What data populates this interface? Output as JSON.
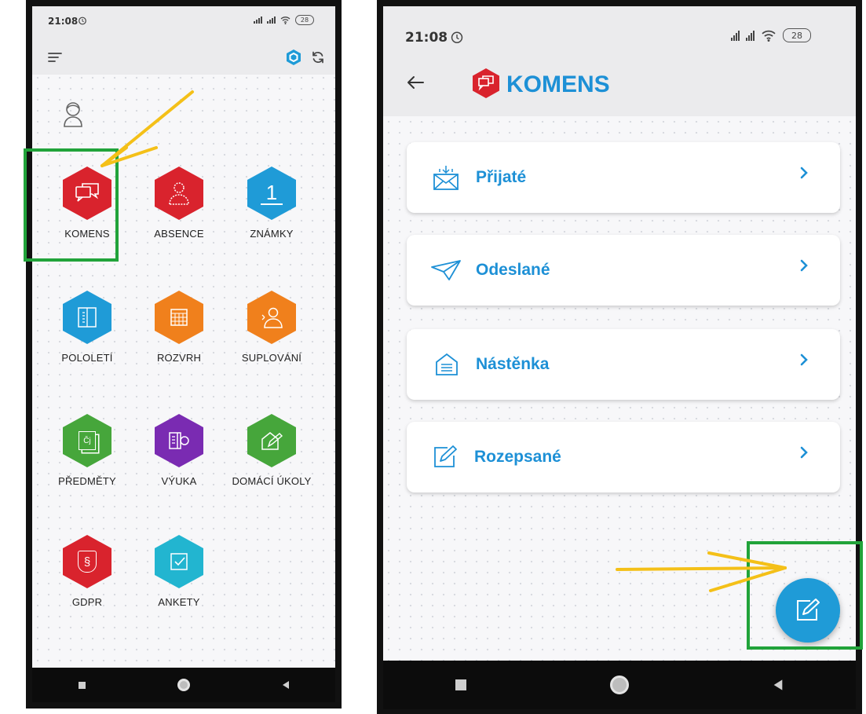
{
  "left_phone": {
    "status": {
      "time": "21:08",
      "battery": "28"
    },
    "tiles": [
      {
        "label": "KOMENS",
        "color": "#d9232d",
        "icon": "chat-bubbles-icon"
      },
      {
        "label": "ABSENCE",
        "color": "#d9232d",
        "icon": "person-outline-icon"
      },
      {
        "label": "ZNÁMKY",
        "color": "#1f9bd7",
        "icon": "number-one-icon",
        "glyph": "1"
      },
      {
        "label": "POLOLETÍ",
        "color": "#1f9bd7",
        "icon": "book-icon"
      },
      {
        "label": "ROZVRH",
        "color": "#f0801c",
        "icon": "calendar-grid-icon"
      },
      {
        "label": "SUPLOVÁNÍ",
        "color": "#f0801c",
        "icon": "person-substitute-icon"
      },
      {
        "label": "PŘEDMĚTY",
        "color": "#46a63b",
        "icon": "subjects-icon",
        "glyph": "Čj"
      },
      {
        "label": "VÝUKA",
        "color": "#7a2bb2",
        "icon": "lesson-book-icon"
      },
      {
        "label": "DOMÁCÍ ÚKOLY",
        "color": "#46a63b",
        "icon": "homework-icon"
      },
      {
        "label": "GDPR",
        "color": "#d9232d",
        "icon": "shield-section-icon",
        "glyph": "§"
      },
      {
        "label": "ANKETY",
        "color": "#22b5d0",
        "icon": "checkbox-icon"
      }
    ]
  },
  "right_phone": {
    "status": {
      "time": "21:08",
      "battery": "28"
    },
    "header": {
      "title": "KOMENS"
    },
    "menu": [
      {
        "label": "Přijaté",
        "icon": "inbox-icon"
      },
      {
        "label": "Odeslané",
        "icon": "send-icon"
      },
      {
        "label": "Nástěnka",
        "icon": "noticeboard-icon"
      },
      {
        "label": "Rozepsané",
        "icon": "draft-icon"
      }
    ],
    "fab": {
      "icon": "compose-icon",
      "color": "#1f9bd7"
    }
  },
  "annotations": {
    "highlight_color": "#21a33a",
    "arrow_color": "#f4c018"
  }
}
